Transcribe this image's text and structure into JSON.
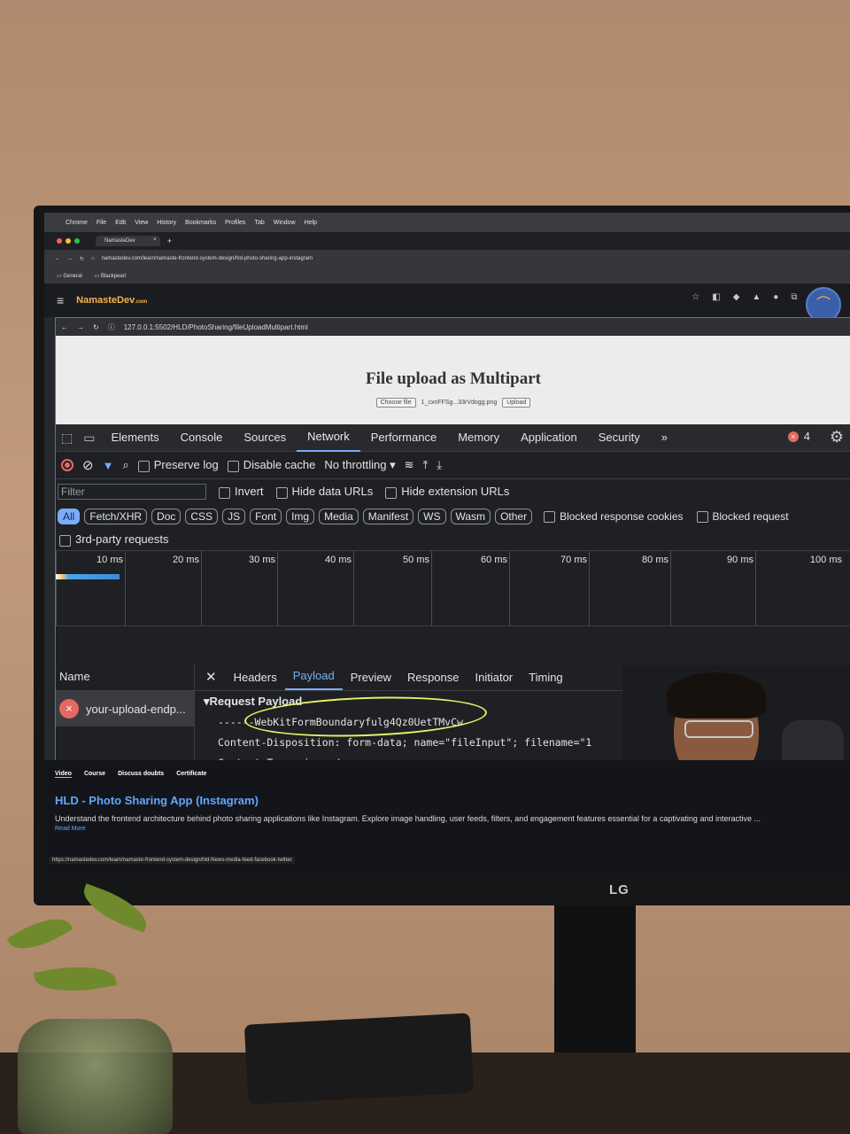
{
  "menubar": {
    "items": [
      "Chrome",
      "File",
      "Edit",
      "View",
      "History",
      "Bookmarks",
      "Profiles",
      "Tab",
      "Window",
      "Help"
    ]
  },
  "browser": {
    "tab_title": "NamasteDev",
    "url": "namastedev.com/learn/namaste-frontend-system-design/hld-photo-sharing-app-instagram",
    "bookmarks": [
      "General",
      "Blackpearl"
    ]
  },
  "site": {
    "logo": "NamasteDev",
    "logo_suffix": ".com"
  },
  "inner_browser": {
    "url": "127.0.0.1:5502/HLD/PhotoSharing/fileUploadMultipart.html"
  },
  "page": {
    "title": "File upload as Multipart",
    "choose_file": "Choose file",
    "file_name": "1_cxnFFSg...33rVdogg.png",
    "upload": "Upload"
  },
  "devtools": {
    "tabs": [
      "Elements",
      "Console",
      "Sources",
      "Network",
      "Performance",
      "Memory",
      "Application",
      "Security"
    ],
    "active_tab": "Network",
    "more": "»",
    "error_count": "4",
    "toolbar": {
      "preserve_log": "Preserve log",
      "disable_cache": "Disable cache",
      "throttling": "No throttling"
    },
    "filter": {
      "placeholder": "Filter",
      "invert": "Invert",
      "hide_data_urls": "Hide data URLs",
      "hide_extension_urls": "Hide extension URLs"
    },
    "types": [
      "All",
      "Fetch/XHR",
      "Doc",
      "CSS",
      "JS",
      "Font",
      "Img",
      "Media",
      "Manifest",
      "WS",
      "Wasm",
      "Other"
    ],
    "blocked_cookies": "Blocked response cookies",
    "blocked_requests": "Blocked request",
    "third_party": "3rd-party requests",
    "timeline_ticks": [
      "10 ms",
      "20 ms",
      "30 ms",
      "40 ms",
      "50 ms",
      "60 ms",
      "70 ms",
      "80 ms",
      "90 ms",
      "100 ms"
    ],
    "name_header": "Name",
    "request_name": "your-upload-endp...",
    "detail_tabs": [
      "Headers",
      "Payload",
      "Preview",
      "Response",
      "Initiator",
      "Timing"
    ],
    "active_detail_tab": "Payload",
    "payload": {
      "header": "Request Payload",
      "lines": [
        "------WebKitFormBoundaryfulg4Qz0UetTMvCw",
        "Content-Disposition: form-data; name=\"fileInput\"; filename=\"1",
        "Content-Type: image/png"
      ]
    }
  },
  "course": {
    "tabs": [
      "Video",
      "Course",
      "Discuss doubts",
      "Certificate"
    ],
    "title": "HLD - Photo Sharing App (Instagram)",
    "description": "Understand the frontend architecture behind photo sharing applications like Instagram. Explore image handling, user feeds, filters, and engagement features essential for a captivating and interactive ...",
    "read_more": "Read More",
    "status_url": "https://namastedev.com/learn/namaste-frontend-system-design/hld-News-media-feed-facebook-twitter"
  },
  "monitor_brand": "LG",
  "colors": {
    "accent": "#7cacf8",
    "error": "#e46962",
    "highlight": "#e6ef6a",
    "brand": "#f6b34a"
  }
}
